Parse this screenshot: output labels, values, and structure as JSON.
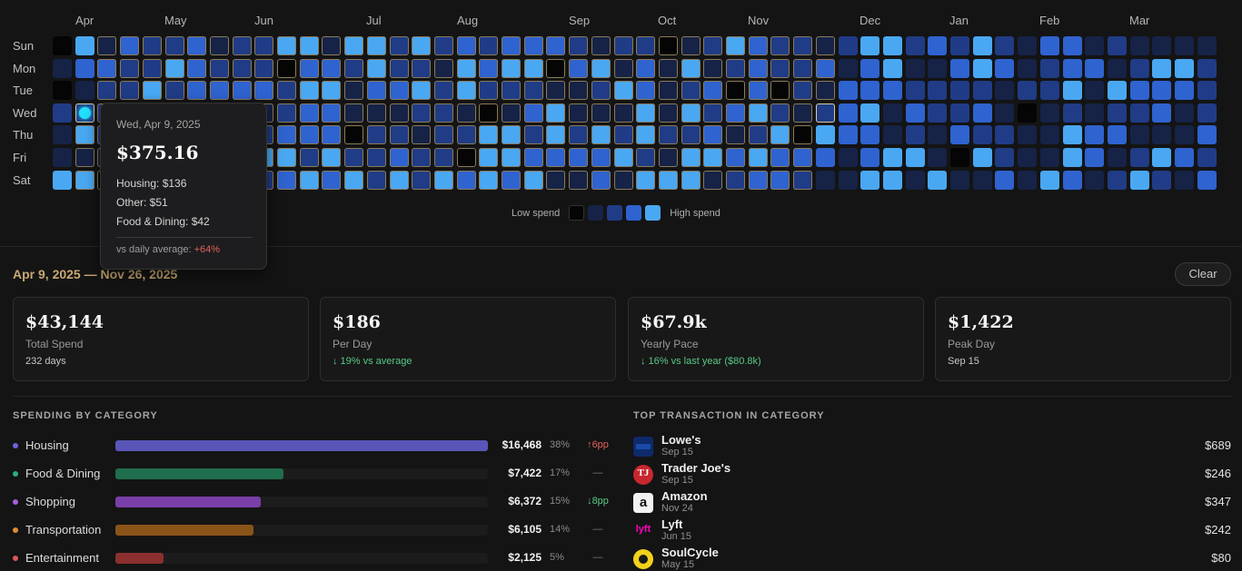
{
  "heatmap": {
    "months": [
      "Apr",
      "May",
      "Jun",
      "Jul",
      "Aug",
      "Sep",
      "Oct",
      "Nov",
      "Dec",
      "Jan",
      "Feb",
      "Mar"
    ],
    "days": [
      "Sun",
      "Mon",
      "Tue",
      "Wed",
      "Thu",
      "Fri",
      "Sat"
    ],
    "legend": {
      "low_label": "Low spend",
      "high_label": "High spend"
    },
    "selected_range": [
      "Apr 9, 2025",
      "Nov 26, 2025"
    ],
    "focused_day": "Wed, Apr 9, 2025"
  },
  "tooltip": {
    "date": "Wed, Apr 9, 2025",
    "amount": "$375.16",
    "lines": [
      "Housing: $136",
      "Other: $51",
      "Food & Dining: $42"
    ],
    "vs_label": "vs daily average: ",
    "vs_value": "+64%"
  },
  "range_label": "Apr 9, 2025 — Nov 26, 2025",
  "clear_label": "Clear",
  "stats": [
    {
      "value": "$43,144",
      "label": "Total Spend",
      "sub": "232 days",
      "tone": "neutral"
    },
    {
      "value": "$186",
      "label": "Per Day",
      "sub": "↓ 19% vs average",
      "tone": "good"
    },
    {
      "value": "$67.9k",
      "label": "Yearly Pace",
      "sub": "↓ 16% vs last year ($80.8k)",
      "tone": "good"
    },
    {
      "value": "$1,422",
      "label": "Peak Day",
      "sub": "Sep 15",
      "tone": "neutral"
    }
  ],
  "categories_title": "SPENDING BY CATEGORY",
  "categories": [
    {
      "name": "Housing",
      "amount": "$16,468",
      "pct": "38%",
      "change": "↑6pp",
      "dir": "up",
      "share": 1.0,
      "color": "#5a55b8"
    },
    {
      "name": "Food & Dining",
      "amount": "$7,422",
      "pct": "17%",
      "change": "—",
      "dir": "flat",
      "share": 0.45,
      "color": "#1f6e4e"
    },
    {
      "name": "Shopping",
      "amount": "$6,372",
      "pct": "15%",
      "change": "↓8pp",
      "dir": "down",
      "share": 0.39,
      "color": "#7a3fa8"
    },
    {
      "name": "Transportation",
      "amount": "$6,105",
      "pct": "14%",
      "change": "—",
      "dir": "flat",
      "share": 0.37,
      "color": "#8a5418"
    },
    {
      "name": "Entertainment",
      "amount": "$2,125",
      "pct": "5%",
      "change": "—",
      "dir": "flat",
      "share": 0.13,
      "color": "#8c2f2f"
    }
  ],
  "dot_colors": [
    "#6a63e0",
    "#2fae79",
    "#a55de0",
    "#e38b32",
    "#e05555"
  ],
  "transactions_title": "TOP TRANSACTION IN CATEGORY",
  "transactions": [
    {
      "merchant": "Lowe's",
      "date": "Sep 15",
      "amount": "$689",
      "icon": "lowes-logo-icon"
    },
    {
      "merchant": "Trader Joe's",
      "date": "Sep 15",
      "amount": "$246",
      "icon": "trader-joes-logo-icon"
    },
    {
      "merchant": "Amazon",
      "date": "Nov 24",
      "amount": "$347",
      "icon": "amazon-logo-icon"
    },
    {
      "merchant": "Lyft",
      "date": "Jun 15",
      "amount": "$242",
      "icon": "lyft-logo-icon"
    },
    {
      "merchant": "SoulCycle",
      "date": "May 15",
      "amount": "$80",
      "icon": "soulcycle-logo-icon"
    }
  ],
  "colors": {
    "level_0": "#050505",
    "level_1": "#162347",
    "level_2": "#203c86",
    "level_3": "#2f63cf",
    "level_4": "#4aa8f3",
    "accent_range": "#c9a873",
    "positive": "#58c985",
    "negative": "#e0625a"
  }
}
